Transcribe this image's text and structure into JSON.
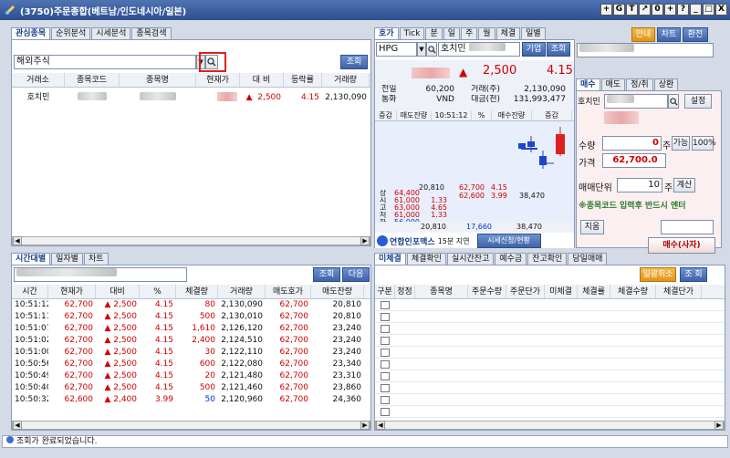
{
  "window": {
    "title": "(3750)주문종합(베트남/인도네시아/일본)"
  },
  "title_buttons": [
    "+",
    "G",
    "T",
    "↗",
    "0",
    "+",
    "?",
    "_",
    "□",
    "X"
  ],
  "watchlist": {
    "tabs": [
      "관심종목",
      "순위분석",
      "시세분석",
      "종목검색"
    ],
    "market_select": "해외주식",
    "query_button": "조회",
    "columns": [
      "거래소",
      "종목코드",
      "종목명",
      "현재가",
      "대 비",
      "등락률",
      "거래량"
    ],
    "rows": [
      {
        "exchange": "호치민",
        "change": "2,500",
        "rate": "4.15",
        "volume": "2,130,090",
        "arrow": "▲"
      }
    ]
  },
  "quote": {
    "tabs": [
      "호가",
      "Tick",
      "분",
      "일",
      "주",
      "월",
      "체결",
      "일별"
    ],
    "code": "HPG",
    "exchange": "호치민",
    "company_button": "기업",
    "query_button": "조회",
    "price_arrow": "▲",
    "change": "2,500",
    "rate": "4.15",
    "info": [
      {
        "l1": "전일",
        "v1": "60,200",
        "l2": "거래(주)",
        "v2": "2,130,090"
      },
      {
        "l1": "통화",
        "v1": "VND",
        "l2": "대금(천)",
        "v2": "131,993,477"
      }
    ],
    "book_header": [
      "증감",
      "매도잔량",
      "10:51:12",
      "%",
      "매수잔량",
      "증감"
    ],
    "ask_price1": "62,700",
    "ask_pct1": "4.15",
    "ask_qty1": "20,810",
    "bid_price1": "62,600",
    "bid_pct1": "3.99",
    "bid_qty1": "38,470",
    "stats": [
      {
        "label": "상",
        "value": "64,400",
        "cls": "red"
      },
      {
        "label": "시",
        "value": "61,000",
        "rate": "1.33",
        "cls": "red"
      },
      {
        "label": "고",
        "value": "63,000",
        "rate": "4.65",
        "cls": "red"
      },
      {
        "label": "저",
        "value": "61,000",
        "rate": "1.33",
        "cls": "red"
      },
      {
        "label": "하",
        "value": "56,000",
        "cls": "blue-t"
      }
    ],
    "total_ask": "20,810",
    "total_diff": "17,660",
    "total_bid": "38,470",
    "footer_brand": "연합인포맥스",
    "footer_delay": "15분 지연",
    "footer_button": "시세신청/현황"
  },
  "top_right": {
    "guide": "안내",
    "chart": "차트",
    "settings": "환전"
  },
  "order": {
    "tabs": [
      "매수",
      "매도",
      "정/취",
      "상환"
    ],
    "exchange": "호치민",
    "settings_button": "설정",
    "qty_label": "수량",
    "qty_value": "0",
    "qty_unit": "주",
    "possible_button": "가능",
    "percent_button": "100%",
    "price_label": "가격",
    "price_value": "62,700.0",
    "unit_label": "매매단위",
    "unit_value": "10",
    "unit_suffix": "주",
    "calc_button": "계산",
    "notice": "※종목코드 입력후 반드시 엔터",
    "clear_button": "지움",
    "buy_button": "매수(사자)"
  },
  "time_sales": {
    "tabs": [
      "시간대별",
      "일자별",
      "차트"
    ],
    "query_button": "조회",
    "next_button": "다음",
    "columns": [
      "시간",
      "현재가",
      "대비",
      "%",
      "체결량",
      "거래량",
      "매도호가",
      "매도잔량"
    ],
    "rows": [
      {
        "time": "10:51:12",
        "price": "62,700",
        "arrow": "▲",
        "diff": "2,500",
        "pct": "4.15",
        "qty": "80",
        "vol": "2,130,090",
        "ask": "62,700",
        "remain": "20,810"
      },
      {
        "time": "10:51:11",
        "price": "62,700",
        "arrow": "▲",
        "diff": "2,500",
        "pct": "4.15",
        "qty": "500",
        "vol": "2,130,010",
        "ask": "62,700",
        "remain": "20,810"
      },
      {
        "time": "10:51:07",
        "price": "62,700",
        "arrow": "▲",
        "diff": "2,500",
        "pct": "4.15",
        "qty": "1,610",
        "vol": "2,126,120",
        "ask": "62,700",
        "remain": "23,240"
      },
      {
        "time": "10:51:02",
        "price": "62,700",
        "arrow": "▲",
        "diff": "2,500",
        "pct": "4.15",
        "qty": "2,400",
        "vol": "2,124,510",
        "ask": "62,700",
        "remain": "23,240"
      },
      {
        "time": "10:51:00",
        "price": "62,700",
        "arrow": "▲",
        "diff": "2,500",
        "pct": "4.15",
        "qty": "30",
        "vol": "2,122,110",
        "ask": "62,700",
        "remain": "23,240"
      },
      {
        "time": "10:50:56",
        "price": "62,700",
        "arrow": "▲",
        "diff": "2,500",
        "pct": "4.15",
        "qty": "600",
        "vol": "2,122,080",
        "ask": "62,700",
        "remain": "23,340"
      },
      {
        "time": "10:50:49",
        "price": "62,700",
        "arrow": "▲",
        "diff": "2,500",
        "pct": "4.15",
        "qty": "20",
        "vol": "2,121,480",
        "ask": "62,700",
        "remain": "23,310"
      },
      {
        "time": "10:50:40",
        "price": "62,700",
        "arrow": "▲",
        "diff": "2,500",
        "pct": "4.15",
        "qty": "500",
        "vol": "2,121,460",
        "ask": "62,700",
        "remain": "23,860"
      },
      {
        "time": "10:50:32",
        "price": "62,600",
        "arrow": "▲",
        "diff": "2,400",
        "pct": "3.99",
        "qty": "50",
        "vol": "2,120,960",
        "ask": "62,700",
        "remain": "24,360"
      }
    ]
  },
  "unfilled": {
    "tabs": [
      "미체결",
      "체결확인",
      "실시간잔고",
      "예수금",
      "잔고확인",
      "당일매매"
    ],
    "cancel_all_button": "일괄취소",
    "query_button": "조 회",
    "columns": [
      "구분",
      "정정",
      "종목명",
      "주문수량",
      "주문단가",
      "미체결",
      "체결률",
      "체결수량",
      "체결단가"
    ]
  },
  "status": {
    "message": "조회가 완료되었습니다."
  }
}
